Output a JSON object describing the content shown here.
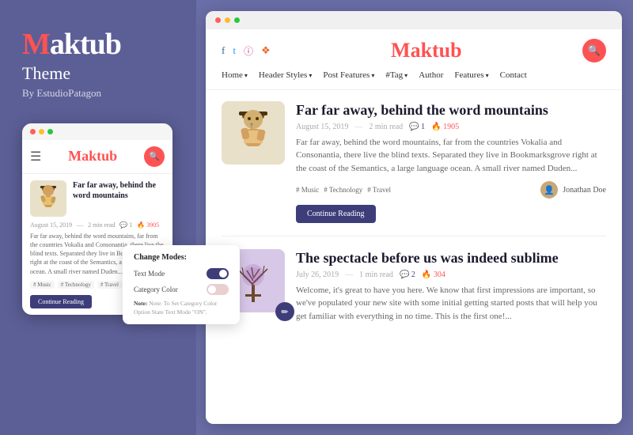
{
  "left": {
    "brand": {
      "name_prefix": "",
      "name_m": "M",
      "name_rest": "aktub",
      "subtitle": "Theme",
      "by": "By EstudioPatagon"
    },
    "mobile": {
      "logo_m": "M",
      "logo_rest": "aktub",
      "post": {
        "title": "Far far away, behind the word mountains",
        "date": "August 15, 2019",
        "read_time": "2 min read",
        "comments": "1",
        "likes": "3905",
        "excerpt": "Far far away, behind the word mountains, far from the countries Vokalia and Consonantia, there live the blind texts. Separated they live in Bookmarksgrove right at the coast of the Semantics, a large language ocean. A small river named Duden...",
        "tags": [
          "# Music",
          "# Technology",
          "# Travel"
        ],
        "continue_label": "Continue Reading"
      }
    },
    "popup": {
      "title": "Change Modes:",
      "row1_label": "Text Mode",
      "row2_label": "Category Color",
      "note": "Note: To Set Category Color Option State Text Mode \"ON\"."
    }
  },
  "right": {
    "social": [
      "f",
      "t",
      "in",
      "rss"
    ],
    "logo_m": "M",
    "logo_rest": "aktub",
    "nav": [
      "Home",
      "Header Styles",
      "Post Features",
      "#Tag",
      "Author",
      "Features",
      "Contact"
    ],
    "posts": [
      {
        "title": "Far far away, behind the word mountains",
        "date": "August 15, 2019",
        "read_time": "2 min read",
        "comments": "1",
        "likes": "1905",
        "excerpt": "Far far away, behind the word mountains, far from the countries Vokalia and Consonantia, there live the blind texts. Separated they live in Bookmarksgrove right at the coast of the Semantics, a large language ocean. A small river named Duden...",
        "tags": [
          "# Music",
          "# Technology",
          "# Travel"
        ],
        "author": "Jonathan Doe",
        "continue_label": "Continue Reading",
        "thumb_type": "beige"
      },
      {
        "title": "The spectacle before us was indeed sublime",
        "date": "July 26, 2019",
        "read_time": "1 min read",
        "comments": "2",
        "likes": "304",
        "excerpt": "Welcome, it's great to have you here. We know that first impressions are important, so we've populated your new site with some initial getting started posts that will help you get familiar with everything in no time. This is the first one!...",
        "tags": [],
        "author": "",
        "continue_label": "",
        "thumb_type": "purple"
      }
    ]
  }
}
